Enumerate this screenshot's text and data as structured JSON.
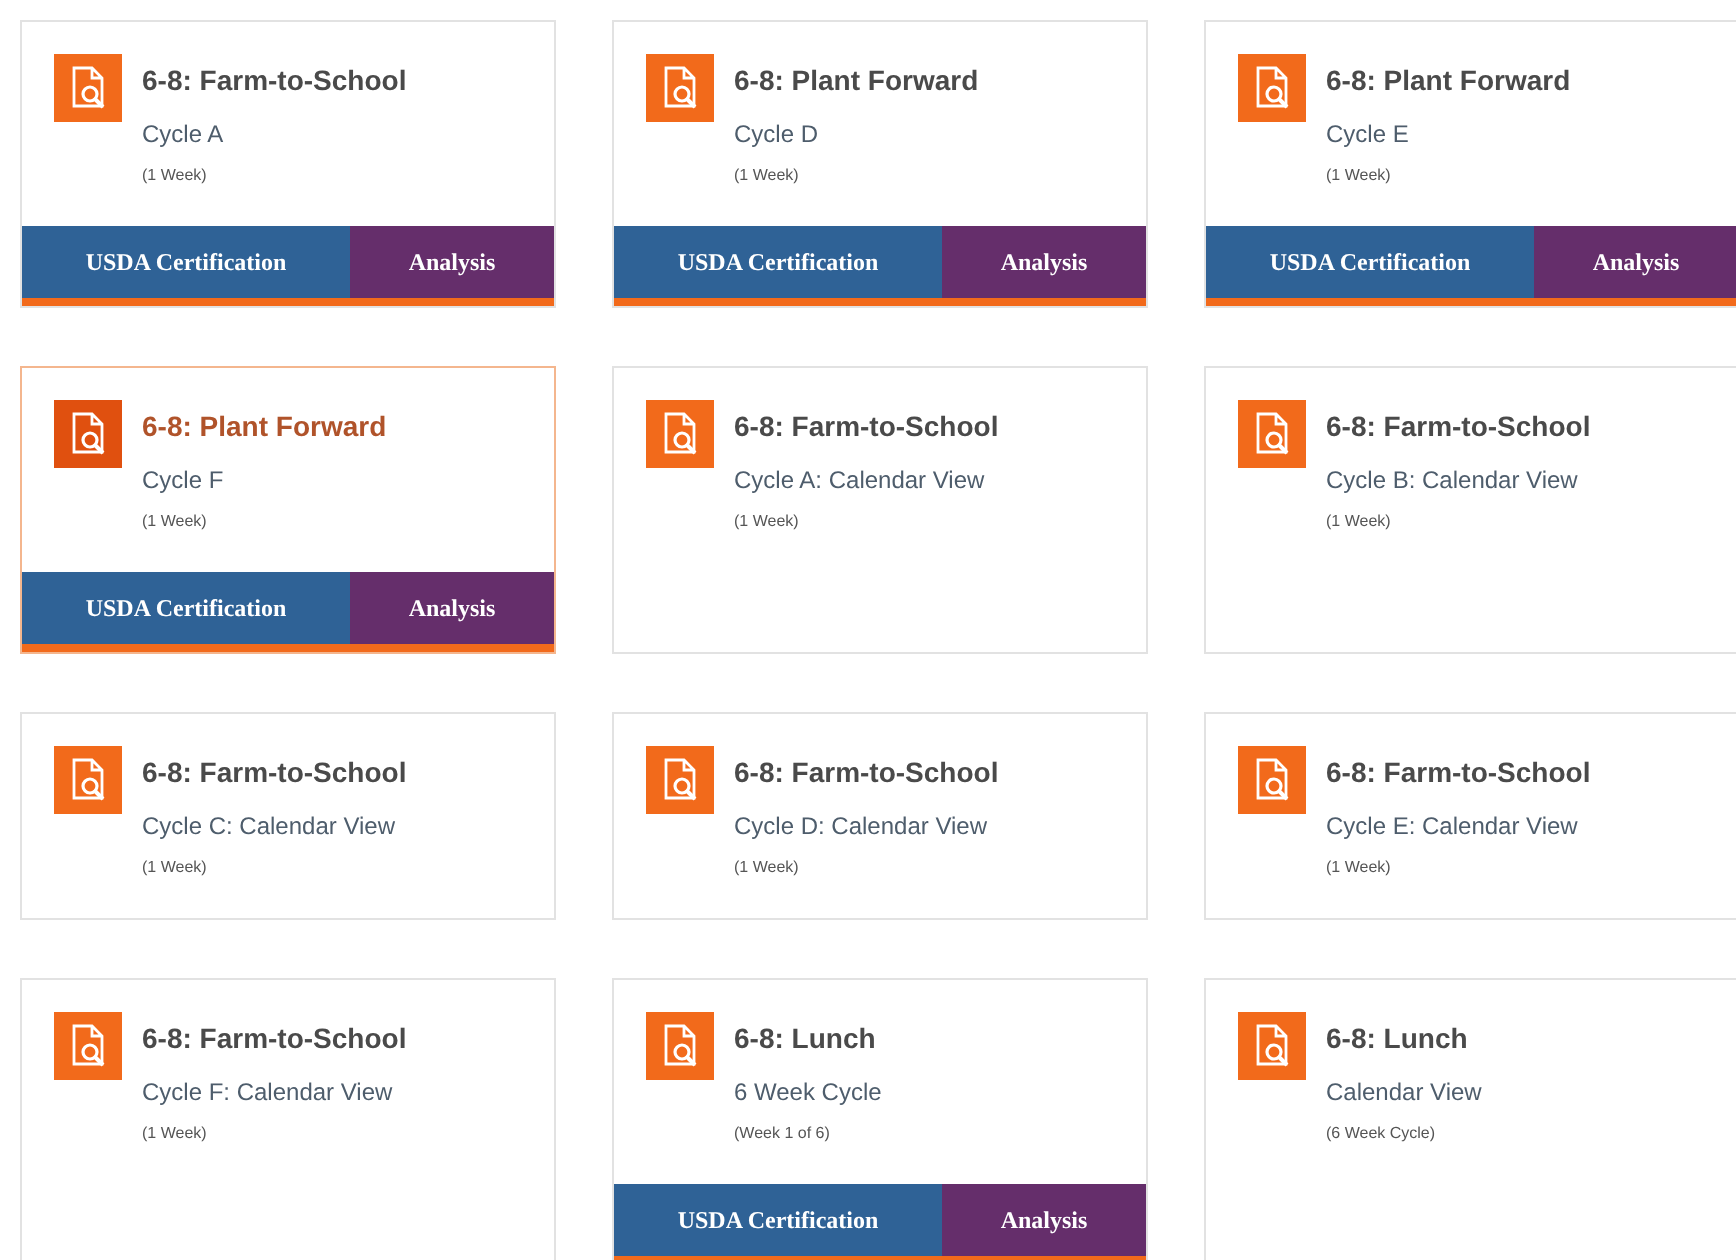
{
  "cards": [
    {
      "title": "6-8: Farm-to-School",
      "subtitle": "Cycle A",
      "note": "(1 Week)",
      "highlighted": false,
      "actions": [
        "USDA Certification",
        "Analysis"
      ]
    },
    {
      "title": "6-8: Plant Forward",
      "subtitle": "Cycle D",
      "note": "(1 Week)",
      "highlighted": false,
      "actions": [
        "USDA Certification",
        "Analysis"
      ]
    },
    {
      "title": "6-8: Plant Forward",
      "subtitle": "Cycle E",
      "note": "(1 Week)",
      "highlighted": false,
      "actions": [
        "USDA Certification",
        "Analysis"
      ]
    },
    {
      "title": "6-8: Plant Forward",
      "subtitle": "Cycle F",
      "note": "(1 Week)",
      "highlighted": true,
      "actions": [
        "USDA Certification",
        "Analysis"
      ]
    },
    {
      "title": "6-8: Farm-to-School",
      "subtitle": "Cycle A: Calendar View",
      "note": "(1 Week)",
      "highlighted": false
    },
    {
      "title": "6-8: Farm-to-School",
      "subtitle": "Cycle B: Calendar View",
      "note": "(1 Week)",
      "highlighted": false
    },
    {
      "title": "6-8: Farm-to-School",
      "subtitle": "Cycle C: Calendar View",
      "note": "(1 Week)",
      "highlighted": false
    },
    {
      "title": "6-8: Farm-to-School",
      "subtitle": "Cycle D: Calendar View",
      "note": "(1 Week)",
      "highlighted": false
    },
    {
      "title": "6-8: Farm-to-School",
      "subtitle": "Cycle E: Calendar View",
      "note": "(1 Week)",
      "highlighted": false
    },
    {
      "title": "6-8: Farm-to-School",
      "subtitle": "Cycle F: Calendar View",
      "note": "(1 Week)",
      "highlighted": false
    },
    {
      "title": "6-8: Lunch",
      "subtitle": "6 Week Cycle",
      "note": "(Week 1 of 6)",
      "highlighted": false,
      "actions": [
        "USDA Certification",
        "Analysis"
      ]
    },
    {
      "title": "6-8: Lunch",
      "subtitle": "Calendar View",
      "note": "(6 Week Cycle)",
      "highlighted": false
    }
  ]
}
